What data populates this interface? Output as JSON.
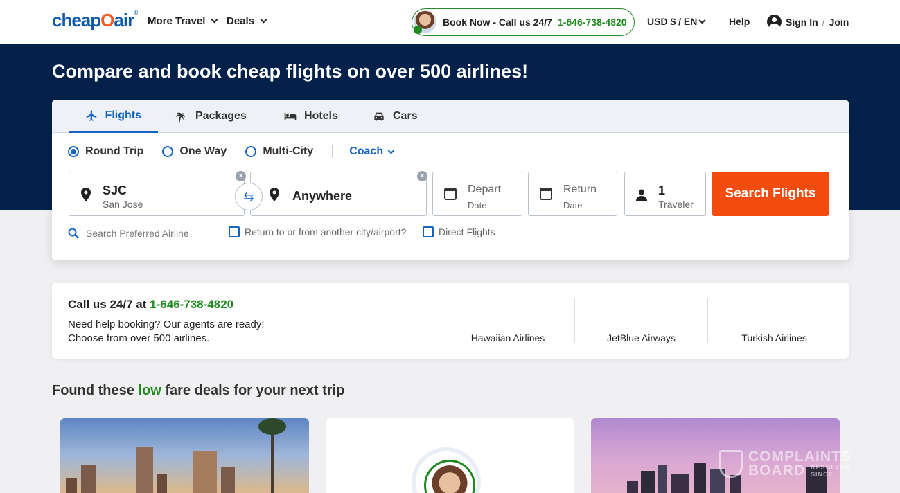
{
  "header": {
    "logo_text": "cheap",
    "logo_zero": "O",
    "logo_air": "air",
    "logo_reg": "®",
    "nav": [
      "More Travel",
      "Deals"
    ],
    "book_label": "Book Now - Call us 24/7",
    "book_phone": "1-646-738-4820",
    "currency": "USD $ / EN",
    "help": "Help",
    "sign_in": "Sign In",
    "sep": "/",
    "join": "Join"
  },
  "hero": {
    "title": "Compare and book cheap flights on over 500 airlines!"
  },
  "tabs": [
    {
      "label": "Flights",
      "icon": "plane-icon",
      "active": true
    },
    {
      "label": "Packages",
      "icon": "palm-tree-icon",
      "active": false
    },
    {
      "label": "Hotels",
      "icon": "bed-icon",
      "active": false
    },
    {
      "label": "Cars",
      "icon": "car-icon",
      "active": false
    }
  ],
  "trip": {
    "options": [
      "Round Trip",
      "One Way",
      "Multi-City"
    ],
    "selected": "Round Trip",
    "cabin": "Coach"
  },
  "fields": {
    "origin_code": "SJC",
    "origin_city": "San Jose",
    "destination": "Anywhere",
    "depart_label": "Depart",
    "depart_sub": "Date",
    "return_label": "Return",
    "return_sub": "Date",
    "travelers_count": "1",
    "travelers_label": "Traveler",
    "search_button": "Search Flights"
  },
  "extras": {
    "airline_placeholder": "Search Preferred Airline",
    "alt_airport": "Return to or from another city/airport?",
    "direct": "Direct Flights"
  },
  "call_card": {
    "title": "Call us 24/7 at",
    "phone": "1-646-738-4820",
    "line1": "Need help booking? Our agents are ready!",
    "line2": "Choose from over 500 airlines.",
    "airlines": [
      "Hawaiian Airlines",
      "JetBlue Airways",
      "Turkish Airlines"
    ]
  },
  "deals": {
    "title_pre": "Found these",
    "title_low": "low",
    "title_post": "fare deals for your next trip"
  },
  "watermark": {
    "line1": "COMPLAINTS",
    "line2": "BOARD",
    "line3": "RESOLVED SINCE"
  },
  "colors": {
    "brand_blue": "#1565c0",
    "hero_navy": "#03214a",
    "cta_orange": "#f44b0e",
    "phone_green": "#1f8a1f"
  }
}
